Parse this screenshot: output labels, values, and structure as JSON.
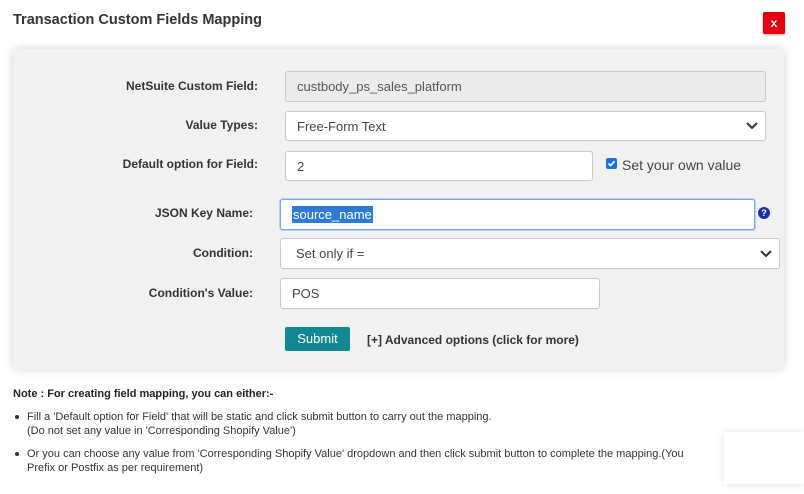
{
  "dialog": {
    "title": "Transaction Custom Fields Mapping",
    "close_label": "x"
  },
  "form": {
    "netsuite_field": {
      "label": "NetSuite Custom Field:",
      "value": "custbody_ps_sales_platform"
    },
    "value_types": {
      "label": "Value Types:",
      "selected": "Free-Form Text"
    },
    "default_option": {
      "label": "Default option for Field:",
      "value": "2"
    },
    "own_value": {
      "label": "Set your own value",
      "checked": true
    },
    "json_key": {
      "label": "JSON Key Name:",
      "value": "source_name"
    },
    "condition": {
      "label": "Condition:",
      "selected": "Set only if ="
    },
    "condition_value": {
      "label": "Condition's Value:",
      "value": "POS"
    },
    "help_label": "?",
    "submit_label": "Submit",
    "advanced_label": "[+] Advanced options (click for more)"
  },
  "note": {
    "heading": "Note : For creating field mapping, you can either:-",
    "items": [
      {
        "line1": "Fill a 'Default option for Field' that will be static and click submit button to carry out the mapping.",
        "line2": "(Do not set any value in 'Corresponding Shopify Value')"
      },
      {
        "line1": "Or you can choose any value from 'Corresponding Shopify Value' dropdown and then click submit button to complete the mapping.(You",
        "line2": "Prefix or Postfix as per requirement)"
      }
    ]
  },
  "colors": {
    "close_button": "#e3000f",
    "submit_button": "#138893",
    "checkbox": "#1a73e8",
    "selection": "#2f7ad6",
    "help_icon": "#1c2fa8"
  }
}
